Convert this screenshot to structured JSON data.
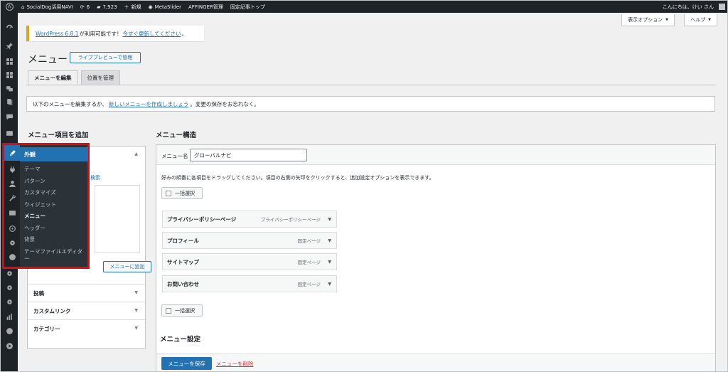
{
  "admin_bar": {
    "site_name": "SocialDog活用NAVI",
    "updates_count": "6",
    "comments_count": "7,923",
    "new_label": "新規",
    "metaslider_label": "MetaSlider",
    "affinger_label": "AFFINGER管理",
    "fixed_article_label": "固定記事トップ",
    "greeting": "こんにちは、けい さん"
  },
  "screen_options": {
    "label": "表示オプション",
    "arrow": "▼"
  },
  "help": {
    "label": "ヘルプ",
    "arrow": "▼"
  },
  "notice": {
    "version_link": "WordPress 6.8.1",
    "mid_text": "が利用可能です！",
    "update_link": "今すぐ更新してください",
    "end_text": "。"
  },
  "page": {
    "title": "メニュー",
    "live_preview_button": "ライブプレビューで管理"
  },
  "tabs": [
    {
      "label": "メニューを編集"
    },
    {
      "label": "位置を管理"
    }
  ],
  "manage": {
    "prefix": "以下のメニューを編集するか、",
    "create_link": "新しいメニューを作成しましょう",
    "suffix": "。変更の保存をお忘れなく。"
  },
  "add_items": {
    "heading": "メニュー項目を追加",
    "search_label": "検索",
    "add_button": "メニューに追加",
    "sections": [
      {
        "label": "投稿"
      },
      {
        "label": "カスタムリンク"
      },
      {
        "label": "カテゴリー"
      }
    ],
    "collapse_arrow": "▲",
    "expand_arrow": "▼"
  },
  "flyout": {
    "header": "外観",
    "items": [
      {
        "label": "テーマ"
      },
      {
        "label": "パターン"
      },
      {
        "label": "カスタマイズ"
      },
      {
        "label": "ウィジェット"
      },
      {
        "label": "メニュー"
      },
      {
        "label": "ヘッダー"
      },
      {
        "label": "背景"
      },
      {
        "label": "テーマファイルエディター"
      }
    ],
    "highlight_color": "#e30613"
  },
  "structure": {
    "heading": "メニュー構造",
    "name_label": "メニュー名",
    "name_value": "グローバルナビ",
    "instructions": "好みの順番に各項目をドラッグしてください。項目の右側の矢印をクリックすると、追加設定オプションを表示できます。",
    "bulk_select": "一括選択",
    "items": [
      {
        "title": "プライバシーポリシーページ",
        "type": "プライバシーポリシーページ"
      },
      {
        "title": "プロフィール",
        "type": "固定ページ"
      },
      {
        "title": "サイトマップ",
        "type": "固定ページ"
      },
      {
        "title": "お問い合わせ",
        "type": "固定ページ"
      }
    ],
    "item_arrow": "▼",
    "settings_heading": "メニュー設定",
    "save_button": "メニューを保存",
    "delete_link": "メニューを削除"
  },
  "colors": {
    "admin_bar": "#1d2327",
    "accent": "#2271b1",
    "notice_border": "#dba617",
    "delete": "#d63638"
  },
  "icons": {
    "side_menu": [
      "dashboard-icon",
      "pin-icon",
      "grid-icon",
      "grid-icon",
      "media-icon",
      "pages-icon",
      "comments-icon",
      "mail-icon",
      "appearance-icon",
      "plugins-icon",
      "users-icon",
      "tools-icon",
      "settings-icon",
      "affinger-icon",
      "gear-icon",
      "wordpress-icon",
      "gear-icon",
      "gear-icon",
      "gear-icon",
      "chart-icon",
      "slider-icon",
      "play-icon"
    ]
  }
}
